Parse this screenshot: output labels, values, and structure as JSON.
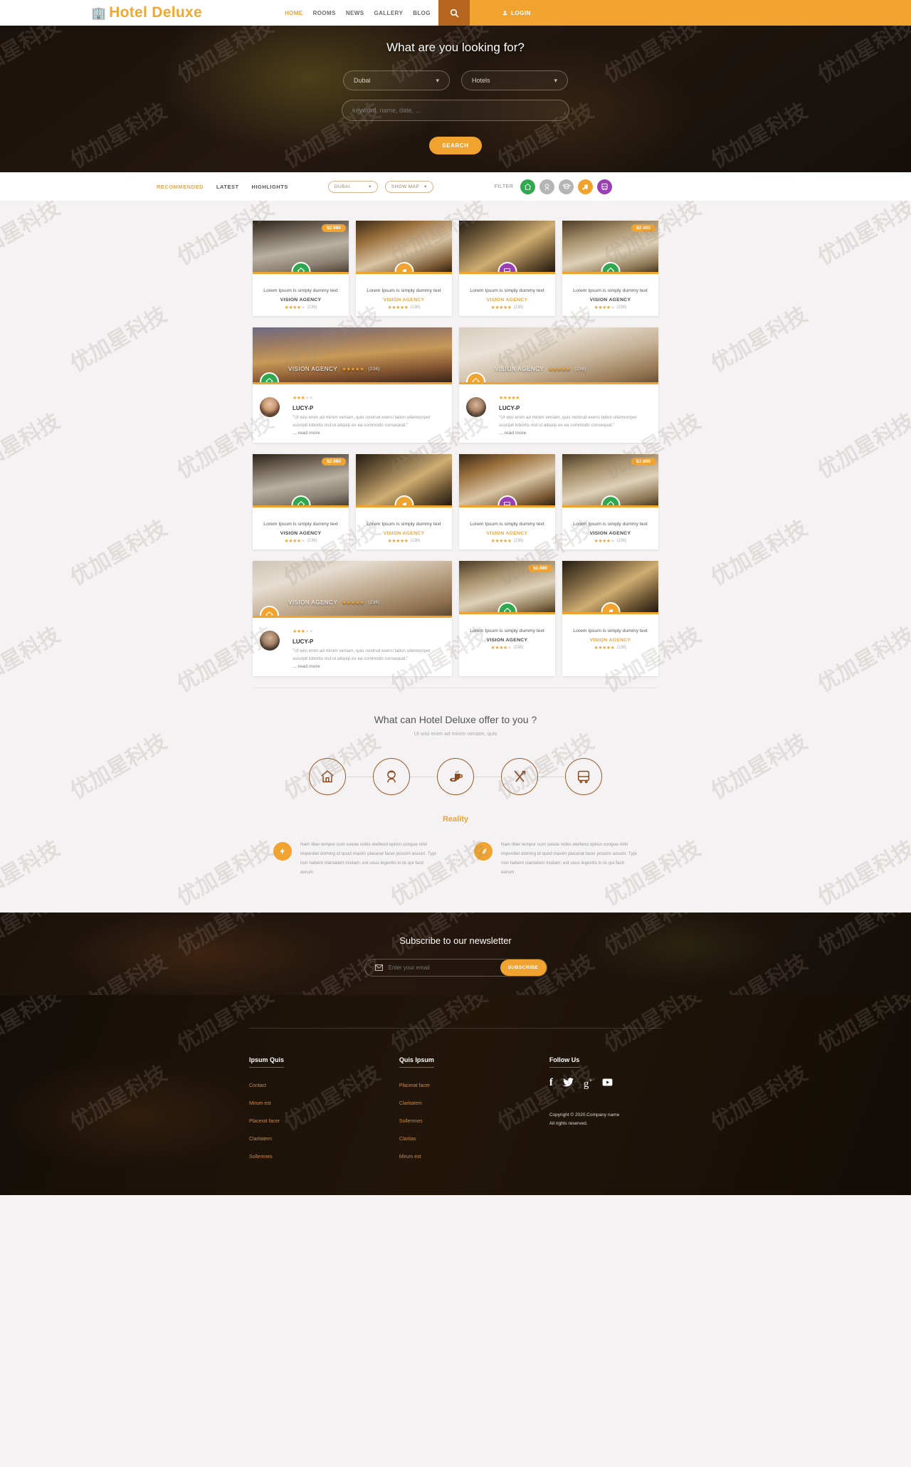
{
  "header": {
    "brand": "Hotel Deluxe",
    "brand_icon": "building-icon",
    "nav": [
      {
        "label": "HOME",
        "active": true
      },
      {
        "label": "ROOMS",
        "active": false
      },
      {
        "label": "NEWS",
        "active": false
      },
      {
        "label": "GALLERY",
        "active": false
      },
      {
        "label": "BLOG",
        "active": false
      }
    ],
    "search_icon": "search-icon",
    "login_label": "LOGIN",
    "login_icon": "user-icon",
    "accent": "#f0a32e",
    "search_bg": "#b5651d"
  },
  "hero": {
    "title": "What are you looking for?",
    "location_select": "Dubai",
    "type_select": "Hotels",
    "keyword_placeholder": "keyword, name, date, ...",
    "search_button": "SEARCH"
  },
  "filterbar": {
    "tabs": [
      {
        "label": "RECOMMENDED",
        "active": true
      },
      {
        "label": "LATEST",
        "active": false
      },
      {
        "label": "HIGHLIGHTS",
        "active": false
      }
    ],
    "city_select": "DUBAI",
    "map_select": "SHOW MAP",
    "filter_label": "FILTER",
    "chips": [
      {
        "name": "home-icon",
        "glyph": "⌂",
        "color": "#2fa84f"
      },
      {
        "name": "person-icon",
        "glyph": "♟",
        "color": "#b5b5b5"
      },
      {
        "name": "graduation-cap-icon",
        "glyph": "☁",
        "color": "#b5b5b5"
      },
      {
        "name": "music-note-icon",
        "glyph": "♫",
        "color": "#f0a32e"
      },
      {
        "name": "bus-icon",
        "glyph": "▣",
        "color": "#9b3fb5"
      }
    ]
  },
  "listings": {
    "row1": [
      {
        "title": "Lorem Ipsum is simply dummy text",
        "agency": "VISION AGENCY",
        "agency_color": "dark",
        "stars": 4,
        "count": "(236)",
        "price": "$2.980",
        "badge": "home-icon",
        "badge_color": "#2fa84f",
        "img": "dining-room"
      },
      {
        "title": "Lorem Ipsum is simply dummy text",
        "agency": "VISION AGENCY",
        "agency_color": "orange",
        "stars": 5,
        "count": "(136)",
        "price": "",
        "badge": "music-note-icon",
        "badge_color": "#f0a32e",
        "img": "restaurant"
      },
      {
        "title": "Lorem Ipsum is simply dummy text",
        "agency": "VISION AGENCY",
        "agency_color": "orange",
        "stars": 5,
        "count": "(136)",
        "price": "",
        "badge": "bus-icon",
        "badge_color": "#9b3fb5",
        "img": "atrium"
      },
      {
        "title": "Lorem Ipsum is simply dummy text",
        "agency": "VISION AGENCY",
        "agency_color": "dark",
        "stars": 4,
        "count": "(236)",
        "price": "$2.980",
        "badge": "home-icon",
        "badge_color": "#2fa84f",
        "img": "kitchen"
      }
    ],
    "row3": [
      {
        "title": "Lorem Ipsum is simply dummy text",
        "agency": "VISION AGENCY",
        "agency_color": "dark",
        "stars": 4,
        "count": "(236)",
        "price": "$2.980",
        "badge": "home-icon",
        "badge_color": "#2fa84f",
        "img": "dining-room"
      },
      {
        "title": "Lorem Ipsum is simply dummy text",
        "agency": "VISION AGENCY",
        "agency_color": "orange",
        "stars": 5,
        "count": "(136)",
        "price": "",
        "badge": "music-note-icon",
        "badge_color": "#f0a32e",
        "img": "atrium"
      },
      {
        "title": "Lorem Ipsum is simply dummy text",
        "agency": "VISION AGENCY",
        "agency_color": "orange",
        "stars": 5,
        "count": "(136)",
        "price": "",
        "badge": "bus-icon",
        "badge_color": "#9b3fb5",
        "img": "restaurant"
      },
      {
        "title": "Lorem Ipsum is simply dummy text",
        "agency": "VISION AGENCY",
        "agency_color": "dark",
        "stars": 4,
        "count": "(236)",
        "price": "$2.980",
        "badge": "home-icon",
        "badge_color": "#2fa84f",
        "img": "kitchen"
      }
    ],
    "row4": [
      {
        "title": "Lorem Ipsum is simply dummy text",
        "agency": "VISION AGENCY",
        "agency_color": "dark",
        "stars": 4,
        "count": "(236)",
        "price": "$2.980",
        "badge": "home-icon",
        "badge_color": "#2fa84f",
        "img": "kitchen"
      },
      {
        "title": "Lorem Ipsum is simply dummy text",
        "agency": "VISION AGENCY",
        "agency_color": "orange",
        "stars": 5,
        "count": "(136)",
        "price": "",
        "badge": "music-note-icon",
        "badge_color": "#f0a32e",
        "img": "atrium"
      }
    ]
  },
  "reviews": [
    {
      "overlay_agency": "VISION AGENCY",
      "overlay_stars": 5,
      "overlay_count": "(236)",
      "badge": "home-icon",
      "badge_color": "#2fa84f",
      "stars": 3,
      "name": "LUCY-P",
      "quote": "\"Ut wisi enim ad minim veniam, quis nostrud exerci tation ullamcorper suscipit lobortis nisl ut aliquip ex ea commodo consequat.\"",
      "readmore": "....read more",
      "img": "atlantis-hotel",
      "avatar": "woman"
    },
    {
      "overlay_agency": "VISION AGENCY",
      "overlay_stars": 5,
      "overlay_count": "(236)",
      "badge": "home-icon",
      "badge_color": "#f0a32e",
      "stars": 5,
      "name": "LUCY-P",
      "quote": "\"Ut wisi enim ad minim veniam, quis nostrud exerci tation ullamcorper suscipit lobortis nisl ut aliquip ex ea commodo consequat.\"",
      "readmore": "....read more",
      "img": "bedroom",
      "avatar": "man"
    },
    {
      "overlay_agency": "VISION AGENCY",
      "overlay_stars": 5,
      "overlay_count": "(236)",
      "badge": "home-icon",
      "badge_color": "#f0a32e",
      "stars": 3,
      "name": "LUCY-P",
      "quote": "\"Ut wisi enim ad minim veniam, quis nostrud exerci tation ullamcorper suscipit lobortis nisl ut aliquip ex ea commodo consequat.\"",
      "readmore": "....read more",
      "img": "bedroom2",
      "avatar": "man"
    }
  ],
  "offer": {
    "title": "What can Hotel Deluxe offer to you ?",
    "subtitle": "Ut wisi enim ad minim veniam, quis",
    "icons": [
      {
        "name": "home-icon",
        "glyph": "⌂"
      },
      {
        "name": "room-service-person-icon",
        "glyph": "♟"
      },
      {
        "name": "coffee-cup-icon",
        "glyph": "☕"
      },
      {
        "name": "fork-knife-icon",
        "glyph": "✕"
      },
      {
        "name": "bus-icon",
        "glyph": "▤"
      }
    ],
    "reality_title": "Reality",
    "features": [
      {
        "icon": "lightning-bolt-icon",
        "glyph": "⚡",
        "text": "Nam liber tempor cum soluta nobis eleifend option congue nihil imperdiet doming id quod maxim placerat facer possim assum. Typi non habent clantatem insitam; est usus legentis in iis qui facit eorum"
      },
      {
        "icon": "leaf-icon",
        "glyph": "❦",
        "text": "Nam liber tempor cum soluta nobis eleifend option congue nihil imperdiet doming id quod maxim placerat facer possim assum. Typi non habent clantatem insitam; est usus legentis in iis qui facit eorum"
      }
    ]
  },
  "newsletter": {
    "title": "Subscribe to our newsletter",
    "email_placeholder": "Enter your email",
    "email_value": "",
    "mail_icon": "envelope-icon",
    "button": "SUBSCRIBE"
  },
  "footer": {
    "columns": [
      {
        "heading": "Ipsum Quis",
        "links": [
          "Contact",
          "Mirum est",
          "Placerat facer",
          "Claritatem",
          "Sollemnes"
        ]
      },
      {
        "heading": "Quis Ipsum",
        "links": [
          "Placerat facer",
          "Claritatem",
          "Sollemnes",
          "Claritas",
          "Mirum est"
        ]
      }
    ],
    "social_heading": "Follow Us",
    "socials": [
      {
        "name": "facebook-icon",
        "glyph": "f"
      },
      {
        "name": "twitter-icon",
        "glyph": "ᵗ"
      },
      {
        "name": "google-plus-icon",
        "glyph": "g"
      },
      {
        "name": "youtube-icon",
        "glyph": "▶"
      }
    ],
    "copyright_line1": "Copyright © 2020.Company name",
    "copyright_line2": "All rights reserved."
  },
  "watermark": "优加星科技"
}
